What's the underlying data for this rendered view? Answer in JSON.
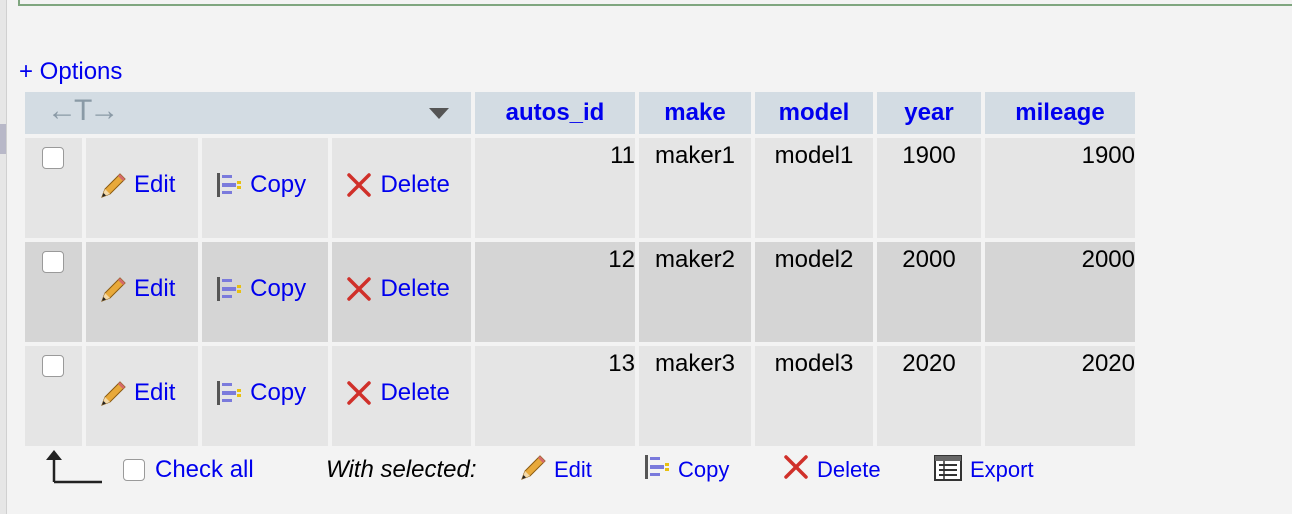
{
  "options_link": "+ Options",
  "header": {
    "tools_arrows": "←T→",
    "columns": [
      "autos_id",
      "make",
      "model",
      "year",
      "mileage"
    ]
  },
  "actions": {
    "edit": "Edit",
    "copy": "Copy",
    "delete": "Delete"
  },
  "rows": [
    {
      "autos_id": "11",
      "make": "maker1",
      "model": "model1",
      "year": "1900",
      "mileage": "1900"
    },
    {
      "autos_id": "12",
      "make": "maker2",
      "model": "model2",
      "year": "2000",
      "mileage": "2000"
    },
    {
      "autos_id": "13",
      "make": "maker3",
      "model": "model3",
      "year": "2020",
      "mileage": "2020"
    }
  ],
  "footer": {
    "check_all": "Check all",
    "with_selected": "With selected:",
    "edit": "Edit",
    "copy": "Copy",
    "delete": "Delete",
    "export": "Export"
  },
  "colors": {
    "link": "#0000ee",
    "header_bg": "#d3dce3",
    "row_light": "#e5e5e5",
    "row_dark": "#d5d5d5"
  }
}
